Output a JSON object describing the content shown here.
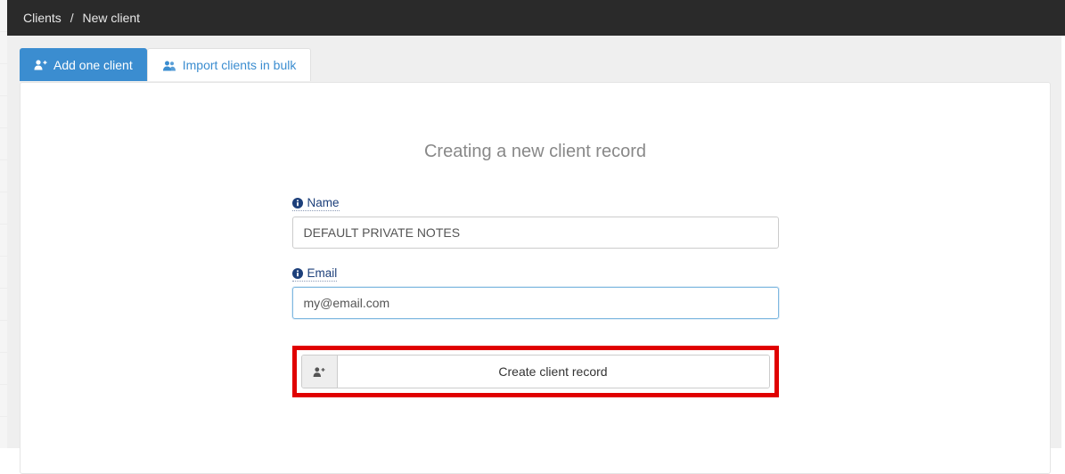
{
  "breadcrumb": {
    "root": "Clients",
    "current": "New client"
  },
  "tabs": {
    "add_one": "Add one client",
    "import_bulk": "Import clients in bulk"
  },
  "panel": {
    "heading": "Creating a new client record"
  },
  "form": {
    "name_label": "Name",
    "name_value": "DEFAULT PRIVATE NOTES",
    "email_label": "Email",
    "email_value": "my@email.com",
    "submit_label": "Create client record"
  },
  "icons": {
    "user_plus": "user-plus-icon",
    "users": "users-icon",
    "info": "info-icon"
  },
  "colors": {
    "topbar_bg": "#2a2a2a",
    "tab_active_bg": "#3b8dd0",
    "link_color": "#3b8dd0",
    "label_color": "#1c3f7a",
    "highlight_border": "#e00000"
  }
}
